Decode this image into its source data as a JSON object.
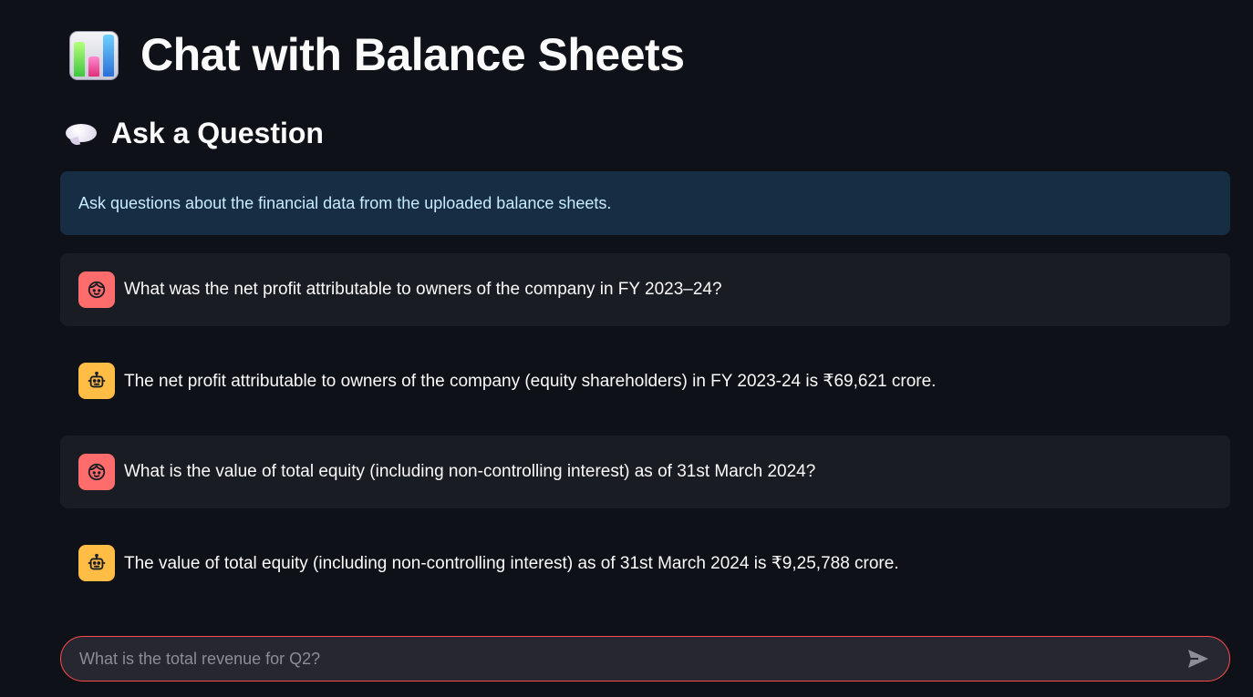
{
  "header": {
    "title": "Chat with Balance Sheets",
    "title_icon": "bar-chart-emoji"
  },
  "section": {
    "subheader": "Ask a Question",
    "subheader_icon": "speech-bubble-emoji"
  },
  "info": {
    "text": "Ask questions about the financial data from the uploaded balance sheets."
  },
  "messages": [
    {
      "role": "user",
      "text": "What was the net profit attributable to owners of the company in FY 2023–24?"
    },
    {
      "role": "assistant",
      "text": "The net profit attributable to owners of the company (equity shareholders) in FY 2023-24 is ₹69,621 crore."
    },
    {
      "role": "user",
      "text": "What is the value of total equity (including non-controlling interest) as of 31st March 2024?"
    },
    {
      "role": "assistant",
      "text": "The value of total equity (including non-controlling interest) as of 31st March 2024 is ₹9,25,788 crore."
    }
  ],
  "chat_input": {
    "placeholder": "What is the total revenue for Q2?",
    "value": ""
  },
  "colors": {
    "background": "#0e1117",
    "accent": "#ff4b4b",
    "user_avatar": "#ff6c6c",
    "bot_avatar": "#ffbd45",
    "info_bg": "#172d43",
    "info_text": "#c7ebff"
  }
}
